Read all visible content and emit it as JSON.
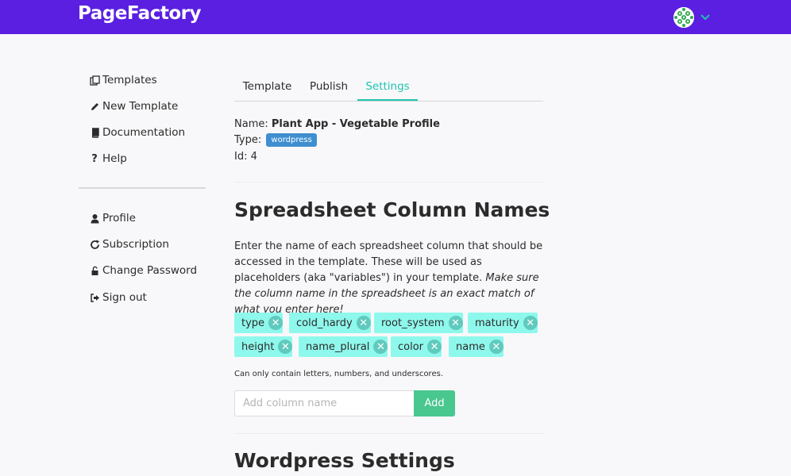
{
  "header": {
    "logo": "PageFactory",
    "colors": {
      "brand": "#5a1fe0",
      "accent": "#1fc4b0",
      "tag_bg": "#8ff8ec",
      "badge": "#3e8ed0",
      "add_button": "#48c78e"
    }
  },
  "sidebar": {
    "primary": [
      {
        "label": "Templates",
        "icon": "copy-icon"
      },
      {
        "label": "New Template",
        "icon": "pencil-icon"
      },
      {
        "label": "Documentation",
        "icon": "book-icon"
      },
      {
        "label": "Help",
        "icon": "question-icon"
      }
    ],
    "account": [
      {
        "label": "Profile",
        "icon": "user-icon"
      },
      {
        "label": "Subscription",
        "icon": "refresh-icon"
      },
      {
        "label": "Change Password",
        "icon": "unlock-icon"
      },
      {
        "label": "Sign out",
        "icon": "sign-out-icon"
      }
    ]
  },
  "tabs": [
    {
      "label": "Template",
      "active": false
    },
    {
      "label": "Publish",
      "active": false
    },
    {
      "label": "Settings",
      "active": true
    }
  ],
  "meta": {
    "name_label": "Name:",
    "name_value": "Plant App - Vegetable Profile",
    "type_label": "Type:",
    "type_value": "wordpress",
    "id_label": "Id:",
    "id_value": "4"
  },
  "columns": {
    "heading": "Spreadsheet Column Names",
    "description": "Enter the name of each spreadsheet column that should be accessed in the template. These will be used as placeholders (aka \"variables\") in your template.",
    "description_emphasis": "Make sure the column name in the spreadsheet is an exact match of what you enter here!",
    "tags": [
      "type",
      "cold_hardy",
      "root_system",
      "maturity",
      "height",
      "name_plural",
      "color",
      "name"
    ],
    "hint": "Can only contain letters, numbers, and underscores.",
    "input_placeholder": "Add column name",
    "input_value": "",
    "add_label": "Add"
  },
  "wordpress": {
    "heading": "Wordpress Settings"
  }
}
